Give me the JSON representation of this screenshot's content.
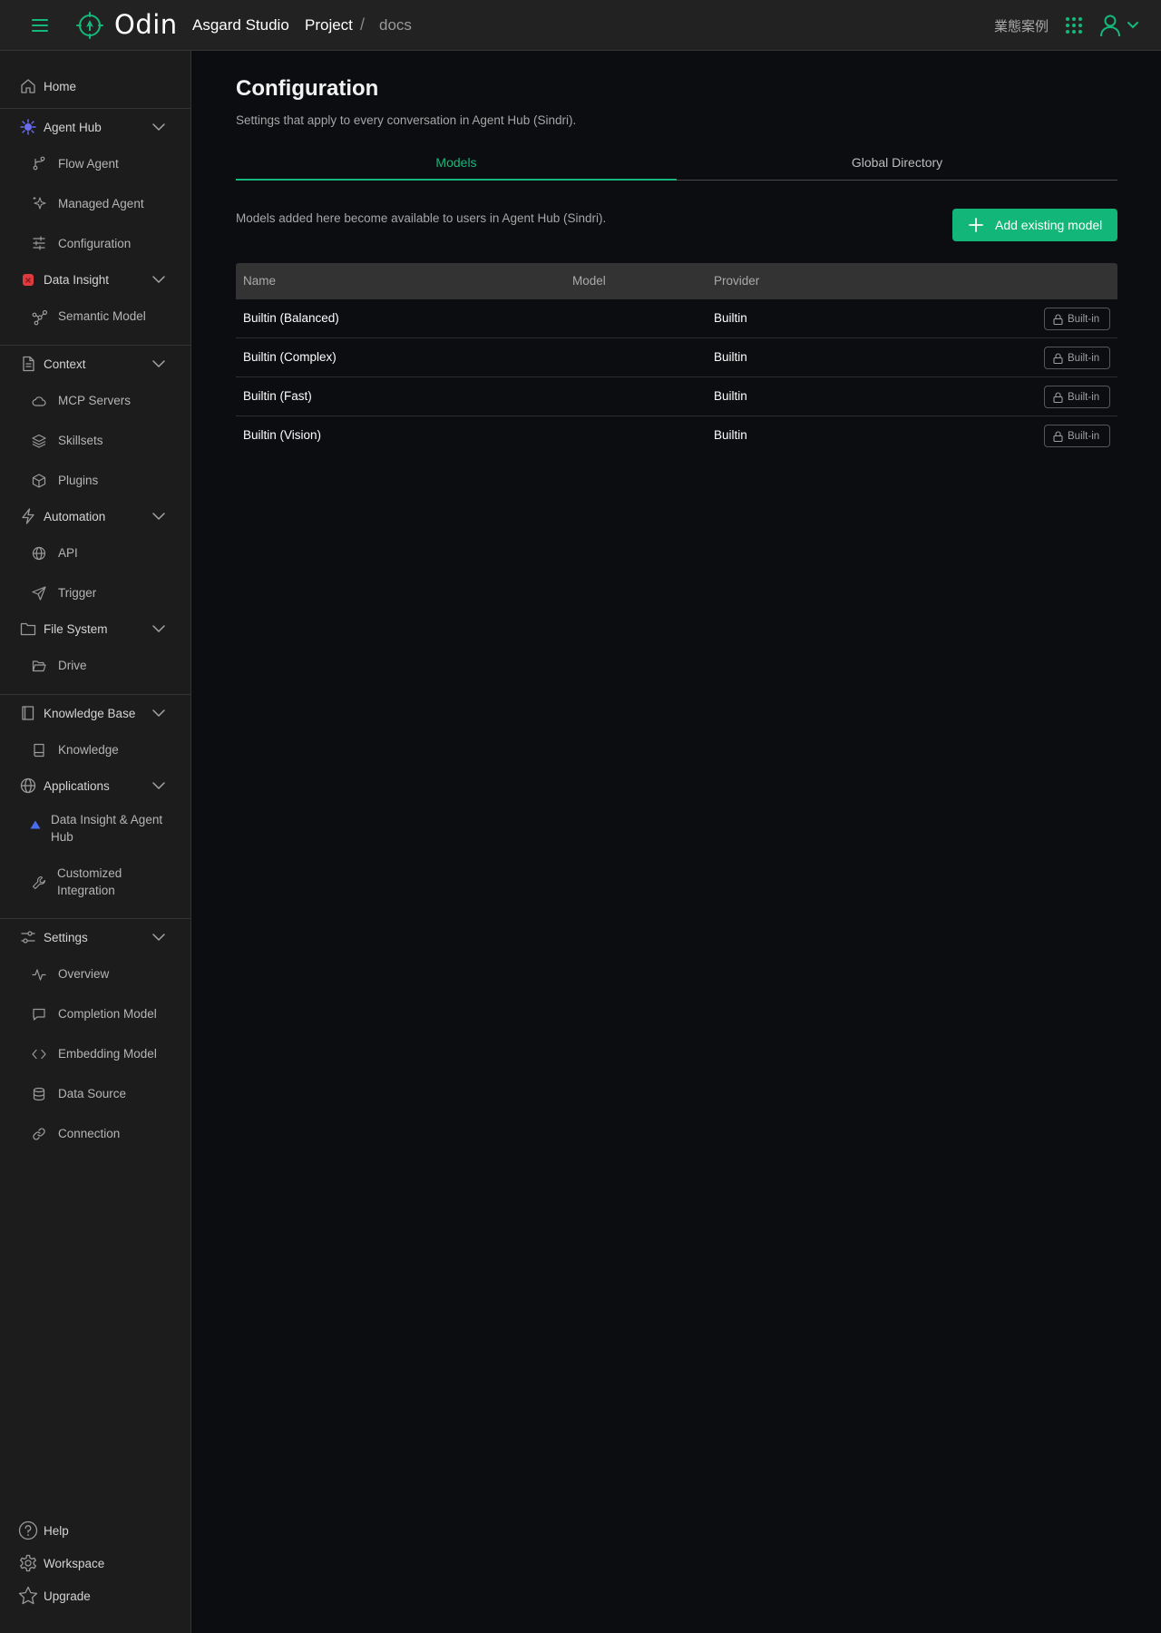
{
  "header": {
    "app_name": "Odin",
    "organization": "Asgard Studio",
    "breadcrumb_project": "Project",
    "breadcrumb_separator": "/",
    "breadcrumb_current": "docs",
    "case_studies": "業態案例"
  },
  "sidebar": {
    "home": "Home",
    "agent_hub": "Agent Hub",
    "flow_agent": "Flow Agent",
    "managed_agent": "Managed Agent",
    "configuration": "Configuration",
    "data_insight": "Data Insight",
    "semantic_model": "Semantic Model",
    "context": "Context",
    "mcp_servers": "MCP Servers",
    "skillsets": "Skillsets",
    "plugins": "Plugins",
    "automation": "Automation",
    "api": "API",
    "trigger": "Trigger",
    "file_system": "File System",
    "drive": "Drive",
    "knowledge_base": "Knowledge Base",
    "knowledge": "Knowledge",
    "applications": "Applications",
    "data_insight_agent_hub": "Data Insight & Agent Hub",
    "customized_integration": "Customized Integration",
    "settings": "Settings",
    "overview": "Overview",
    "completion_model": "Completion Model",
    "embedding_model": "Embedding Model",
    "data_source": "Data Source",
    "connection": "Connection",
    "help": "Help",
    "workspace": "Workspace",
    "upgrade": "Upgrade"
  },
  "main": {
    "title": "Configuration",
    "subtitle": "Settings that apply to every conversation in Agent Hub (Sindri).",
    "tabs": {
      "models": "Models",
      "global_directory": "Global Directory"
    },
    "models_description": "Models added here become available to users in Agent Hub (Sindri).",
    "add_button": "Add existing model",
    "table": {
      "headers": {
        "name": "Name",
        "model": "Model",
        "provider": "Provider"
      },
      "rows": [
        {
          "name": "Builtin (Balanced)",
          "model": "",
          "provider": "Builtin",
          "badge": "Built-in"
        },
        {
          "name": "Builtin (Complex)",
          "model": "",
          "provider": "Builtin",
          "badge": "Built-in"
        },
        {
          "name": "Builtin (Fast)",
          "model": "",
          "provider": "Builtin",
          "badge": "Built-in"
        },
        {
          "name": "Builtin (Vision)",
          "model": "",
          "provider": "Builtin",
          "badge": "Built-in"
        }
      ]
    }
  },
  "colors": {
    "accent": "#12b678",
    "background": "#0c0d11",
    "sidebar": "#1c1c1c",
    "topbar": "#222222",
    "agent_hub_icon": "#6a6cf0",
    "data_insight_icon": "#e0393e"
  },
  "icons": {
    "menu": "hamburger-icon",
    "logo": "odin-compass-icon",
    "apps": "grid-dots-icon",
    "user": "user-icon",
    "lock": "lock-icon"
  }
}
